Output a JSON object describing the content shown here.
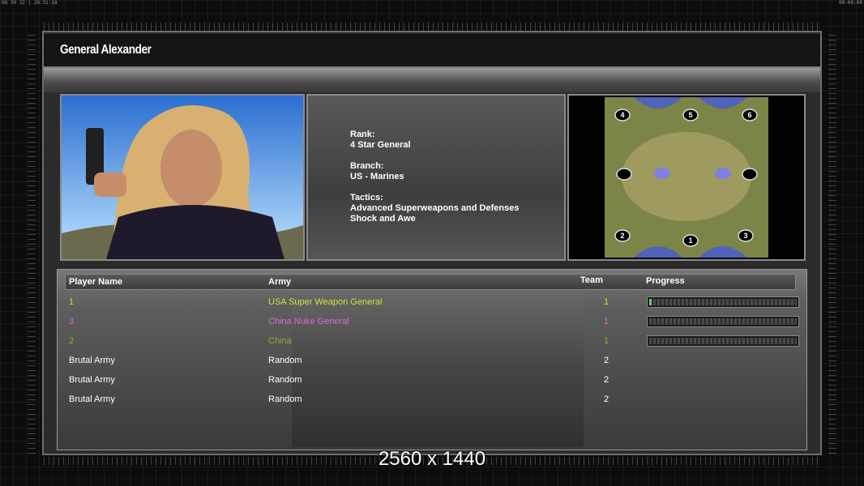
{
  "hud": {
    "left": "08 30 32 | 20:31:18",
    "right": "00:00:00"
  },
  "general": {
    "name": "General Alexander",
    "rank_label": "Rank:",
    "rank_value": "4 Star General",
    "branch_label": "Branch:",
    "branch_value": "US - Marines",
    "tactics_label": "Tactics:",
    "tactics_line1": "Advanced Superweapons and Defenses",
    "tactics_line2": "Shock and Awe"
  },
  "minimap": {
    "start_positions": [
      "4",
      "5",
      "6",
      "2",
      "1",
      "3"
    ]
  },
  "lobby": {
    "columns": {
      "player": "Player Name",
      "army": "Army",
      "team": "Team",
      "progress": "Progress"
    },
    "players": [
      {
        "name": "1",
        "army": "USA Super Weapon General",
        "team": "1",
        "color": "#d7df3b",
        "progress": 0.01
      },
      {
        "name": "3",
        "army": "China Nuke General",
        "team": "1",
        "color": "#d86bd8",
        "progress": 0.0
      },
      {
        "name": "2",
        "army": "China",
        "team": "1",
        "color": "#9aa43a",
        "progress": 0.0
      },
      {
        "name": "Brutal Army",
        "army": "Random",
        "team": "2",
        "color": "#ffffff"
      },
      {
        "name": "Brutal Army",
        "army": "Random",
        "team": "2",
        "color": "#ffffff"
      },
      {
        "name": "Brutal Army",
        "army": "Random",
        "team": "2",
        "color": "#ffffff"
      }
    ]
  },
  "watermark": "2560 x 1440"
}
